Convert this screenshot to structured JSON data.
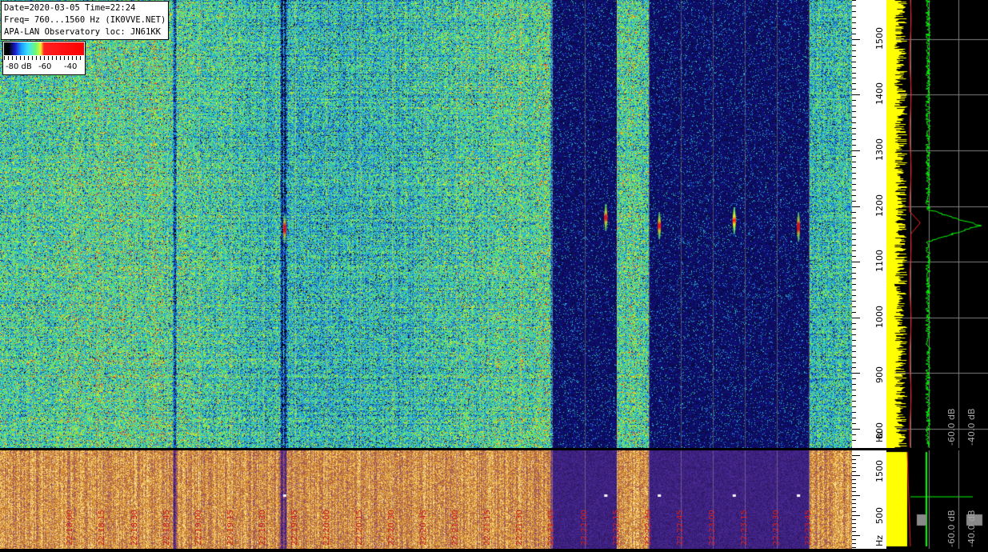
{
  "info": {
    "line1": "Date=2020-03-05 Time=22:24",
    "line2": "Freq= 760...1560 Hz (IK0VVE.NET)",
    "line3": "APA-LAN Observatory loc: JN61KK"
  },
  "colorbar": {
    "label_a": "-80 dB",
    "label_b": "-60",
    "label_c": "-40"
  },
  "colors": {
    "waterfall_high": "#ff0000",
    "spectrum_yellow": "#ffff00",
    "spectrum_green": "#00ff00",
    "time_label": "#d02020"
  },
  "chart_data": {
    "type": "heatmap",
    "freq_range_hz": [
      760,
      1560
    ],
    "freq_ticks": [
      "1500",
      "1400",
      "1300",
      "1200",
      "1100",
      "1000",
      "900",
      "800"
    ],
    "freq_unit": "Hz",
    "db_range": [
      -80,
      -40
    ],
    "spectrum_db_labels": [
      "-60.0 dB",
      "-40.0 dB"
    ],
    "bottom_freq_ticks": [
      "1500",
      "500"
    ],
    "bottom_freq_unit": "Hz",
    "time_labels": [
      "22:18:00",
      "22:18:15",
      "22:18:30",
      "22:18:45",
      "22:19:00",
      "22:19:15",
      "22:19:30",
      "22:19:45",
      "22:20:00",
      "22:20:15",
      "22:20:30",
      "22:20:45",
      "22:21:00",
      "22:21:15",
      "22:21:30",
      "22:21:45",
      "22:22:00",
      "22:22:15",
      "22:22:30",
      "22:22:45",
      "22:23:00",
      "22:23:15",
      "22:23:30",
      "22:23:45"
    ],
    "quiet_intervals": [
      [
        "22:21:45",
        "22:22:15"
      ],
      [
        "22:22:30",
        "22:23:45"
      ]
    ],
    "echoes": [
      {
        "time": "22:19:40",
        "freq_hz": 1160,
        "level_db": -40
      },
      {
        "time": "22:22:10",
        "freq_hz": 1180,
        "level_db": -45
      },
      {
        "time": "22:22:35",
        "freq_hz": 1165,
        "level_db": -45
      },
      {
        "time": "22:23:10",
        "freq_hz": 1175,
        "level_db": -48
      },
      {
        "time": "22:23:40",
        "freq_hz": 1163,
        "level_db": -40
      }
    ]
  }
}
